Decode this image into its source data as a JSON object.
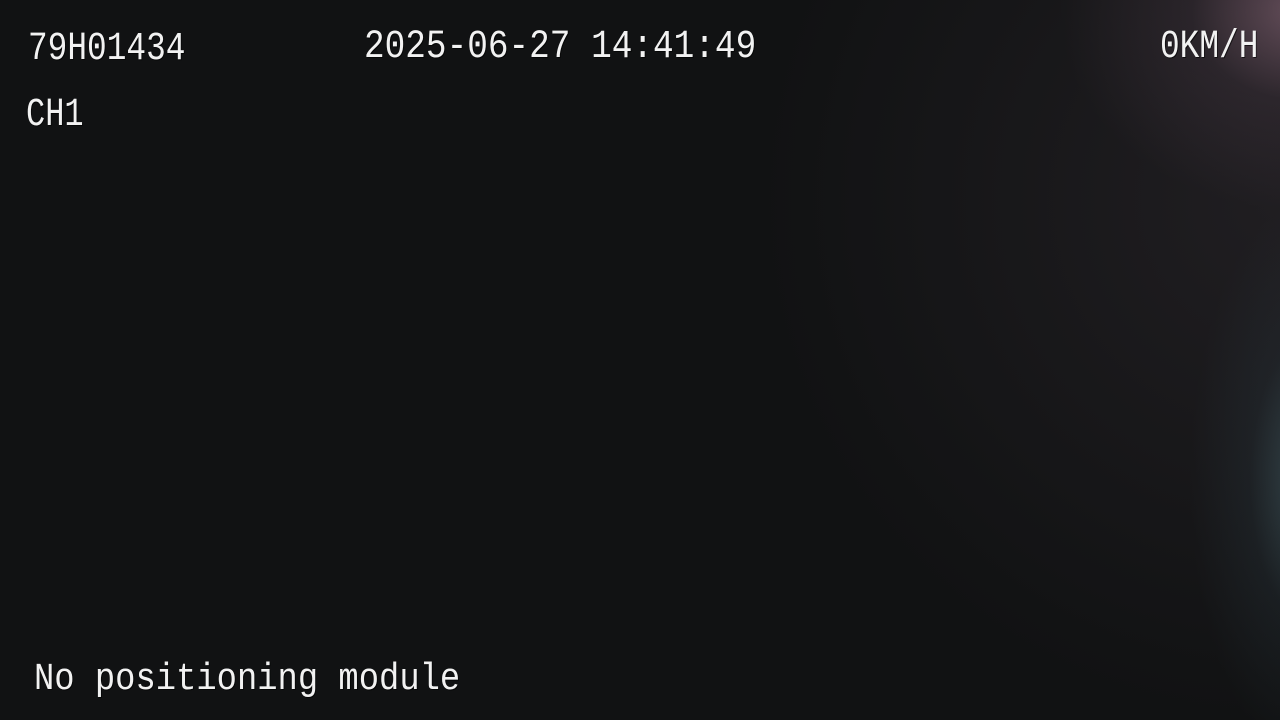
{
  "overlay": {
    "plate": "79H01434",
    "datetime": "2025-06-27 14:41:49",
    "speed": "0KM/H",
    "channel": "CH1",
    "status": "No positioning module"
  },
  "colors": {
    "background": "#111213",
    "text": "#f2f2f2"
  }
}
